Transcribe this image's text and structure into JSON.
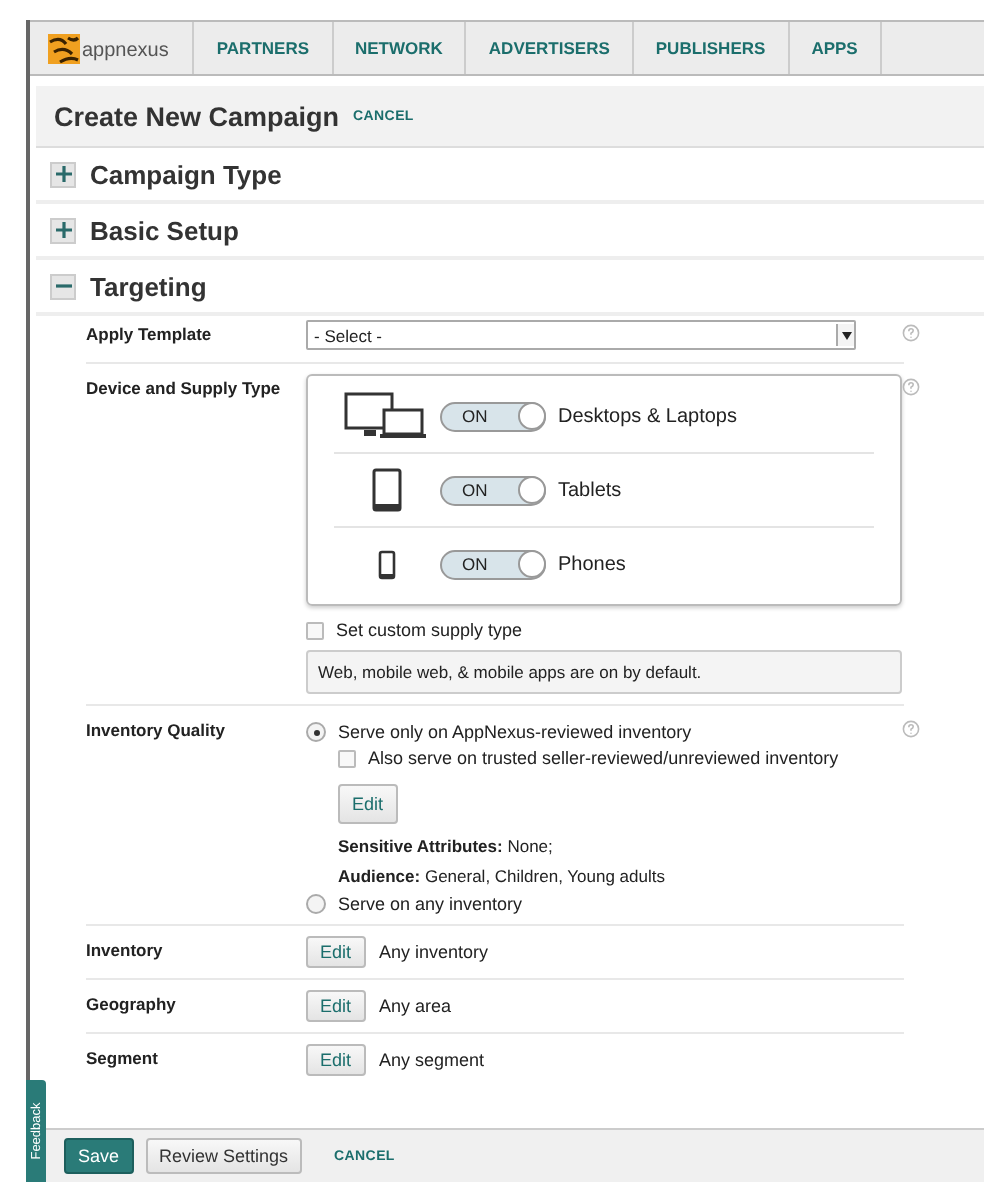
{
  "nav": {
    "logo": "appnexus",
    "items": [
      {
        "label": "PARTNERS",
        "selected": false
      },
      {
        "label": "NETWORK",
        "selected": false
      },
      {
        "label": "ADVERTISERS",
        "selected": false
      },
      {
        "label": "PUBLISHERS",
        "selected": false
      },
      {
        "label": "APPS",
        "selected": false
      }
    ]
  },
  "page_header": {
    "title": "Create New Campaign",
    "cancel": "CANCEL"
  },
  "sections": [
    {
      "title": "Campaign Type",
      "expanded": false
    },
    {
      "title": "Basic Setup",
      "expanded": false
    },
    {
      "title": "Targeting",
      "expanded": true
    }
  ],
  "targeting": [
    {
      "kind": "select",
      "label": "Apply Template",
      "value": "- Select -",
      "help": true
    },
    {
      "kind": "devices",
      "label": "Device and Supply Type",
      "help": true,
      "devices": [
        {
          "kind": "desktop",
          "toggle": "ON",
          "on": true,
          "label": "Desktops & Laptops"
        },
        {
          "kind": "tablet",
          "toggle": "ON",
          "on": true,
          "label": "Tablets"
        },
        {
          "kind": "phone",
          "toggle": "ON",
          "on": true,
          "label": "Phones"
        }
      ],
      "custom": {
        "label": "Set custom supply type",
        "checked": false
      },
      "note": "Web, mobile web, & mobile apps are on by default."
    },
    {
      "kind": "quality",
      "label": "Inventory Quality",
      "help": true,
      "options": [
        {
          "label": "Serve only on AppNexus-reviewed inventory",
          "selected": true,
          "also": {
            "label": "Also serve on trusted seller-reviewed/unreviewed inventory",
            "checked": false
          },
          "edit": "Edit",
          "details": [
            "**Sensitive Attributes:** None;",
            "**Audience:** General, Children, Young adults"
          ]
        },
        {
          "label": "Serve on any inventory",
          "selected": false
        }
      ]
    },
    {
      "kind": "edit",
      "label": "Inventory",
      "button": "Edit",
      "value": "Any inventory"
    },
    {
      "kind": "edit",
      "label": "Geography",
      "button": "Edit",
      "value": "Any area"
    },
    {
      "kind": "edit",
      "label": "Segment",
      "button": "Edit",
      "value": "Any segment"
    }
  ],
  "feedback": "Feedback",
  "footer": {
    "save": "Save",
    "review": "Review Settings",
    "cancel": "CANCEL"
  }
}
